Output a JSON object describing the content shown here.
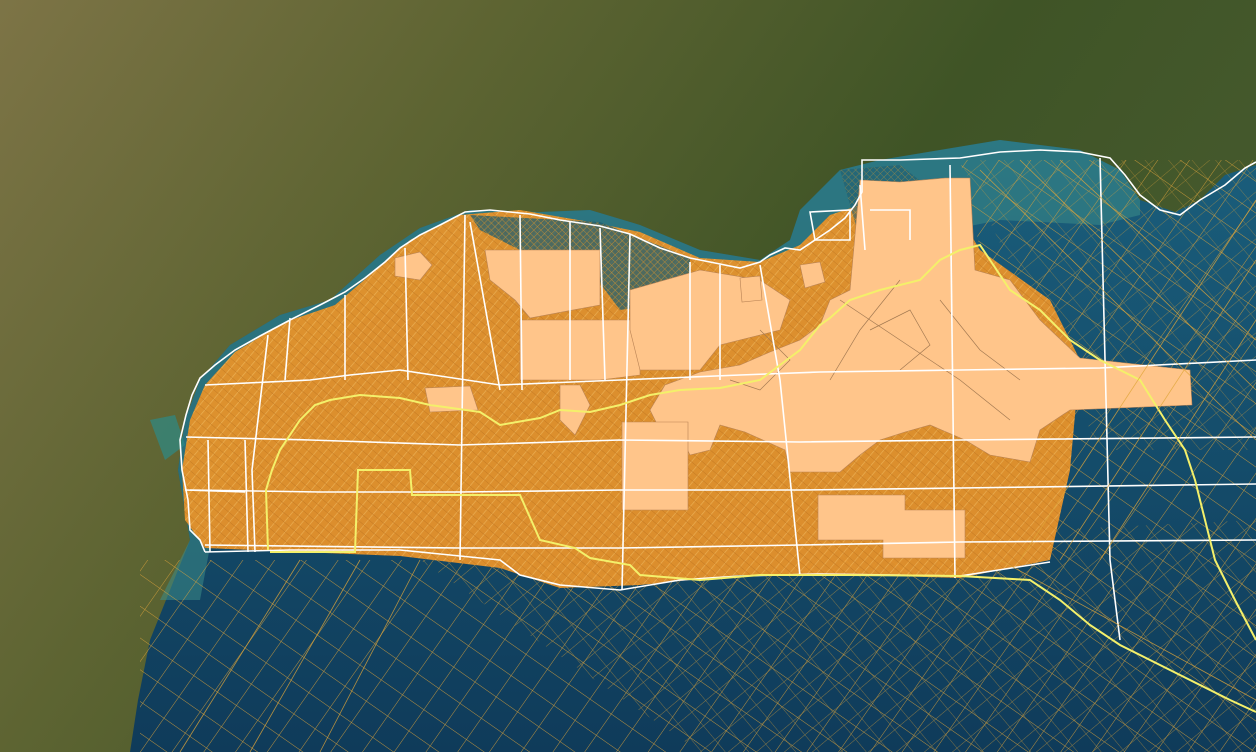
{
  "map": {
    "basemap": "satellite-imagery",
    "region": "gulf-coast-offshore",
    "colors": {
      "land_dark": "#4a5a2c",
      "land_light": "#7a7448",
      "water_deep": "#123f5e",
      "water_shelf": "#1f6a84",
      "water_coastal": "#3c8e8a",
      "survey_fill": "#f2a12e",
      "survey_lines": "#e0a63a",
      "lease_fill": "#ffc58a",
      "boundary_white": "#ffffff",
      "boundary_yellow": "#f4f06a"
    },
    "layers": [
      {
        "id": "basemap",
        "type": "raster-imagery"
      },
      {
        "id": "survey-coverage",
        "type": "line-grid"
      },
      {
        "id": "lease-polygons",
        "type": "polygon-fill"
      },
      {
        "id": "planning-area-blocks",
        "type": "outline"
      },
      {
        "id": "boundary-line",
        "type": "outline"
      }
    ]
  }
}
